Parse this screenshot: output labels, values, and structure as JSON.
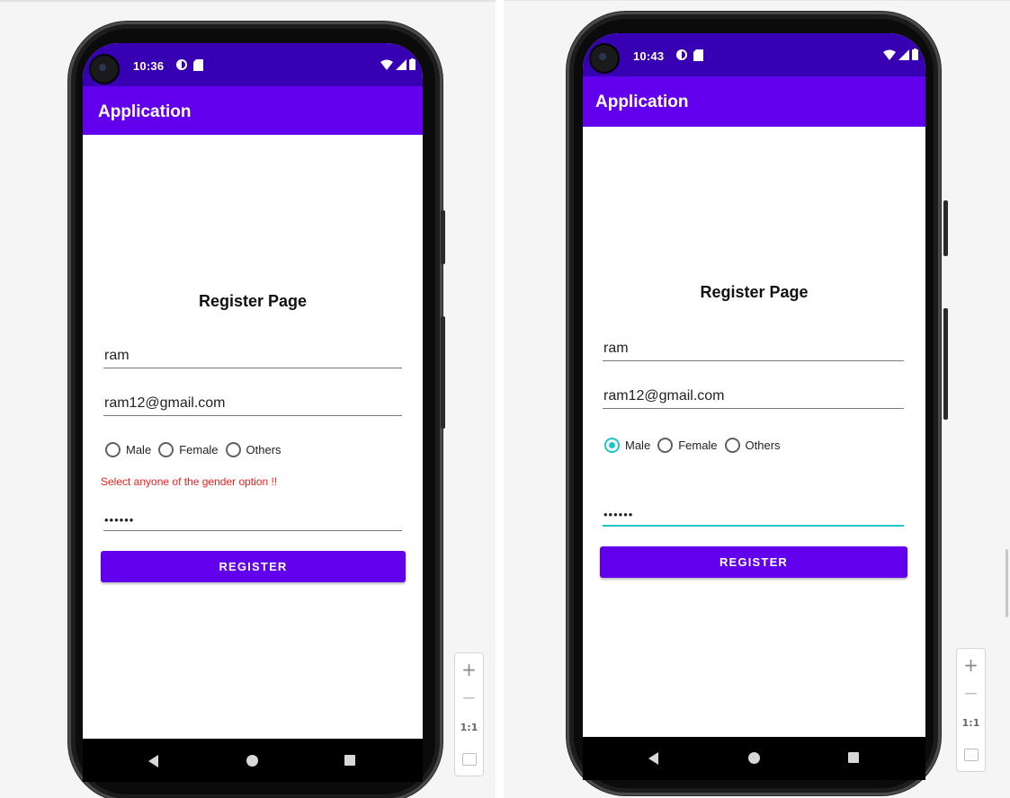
{
  "left": {
    "status_time": "10:36",
    "app_title": "Application",
    "page_title": "Register Page",
    "name_value": "ram",
    "email_value": "ram12@gmail.com",
    "gender_options": [
      "Male",
      "Female",
      "Others"
    ],
    "gender_selected": null,
    "error_message": "Select anyone of the gender option !!",
    "password_value": "••••••",
    "register_label": "REGISTER"
  },
  "right": {
    "status_time": "10:43",
    "app_title": "Application",
    "page_title": "Register Page",
    "name_value": "ram",
    "email_value": "ram12@gmail.com",
    "gender_options": [
      "Male",
      "Female",
      "Others"
    ],
    "gender_selected": "Male",
    "password_value": "••••••",
    "register_label": "REGISTER"
  },
  "zoom_controls": {
    "plus": "+",
    "minus": "−",
    "one_to_one": "1:1"
  },
  "colors": {
    "appbar": "#6200ee",
    "statusbar": "#3700b3",
    "accent": "#1ec7c7",
    "error": "#ff1a1a"
  },
  "icons": [
    "back-icon",
    "home-icon",
    "recents-icon",
    "wifi-icon",
    "signal-icon",
    "battery-icon",
    "sync-icon",
    "sd-card-icon"
  ]
}
